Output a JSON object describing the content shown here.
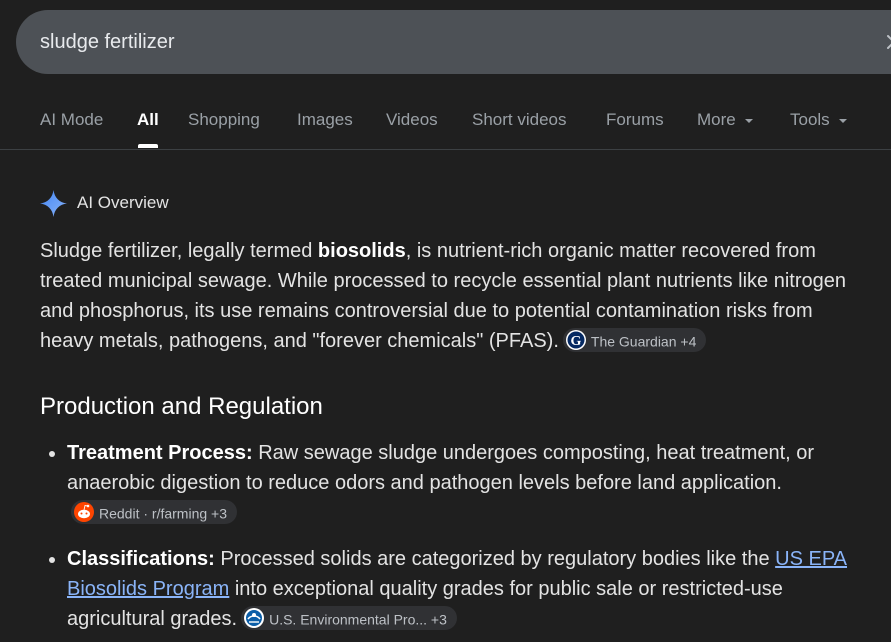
{
  "search": {
    "query": "sludge fertilizer"
  },
  "tabs": [
    {
      "label": "AI Mode"
    },
    {
      "label": "All"
    },
    {
      "label": "Shopping"
    },
    {
      "label": "Images"
    },
    {
      "label": "Videos"
    },
    {
      "label": "Short videos"
    },
    {
      "label": "Forums"
    },
    {
      "label": "More"
    },
    {
      "label": "Tools"
    }
  ],
  "ai_overview": {
    "title": "AI Overview",
    "intro_before": "Sludge fertilizer, legally termed ",
    "intro_bold": "biosolids",
    "intro_after": ", is nutrient-rich organic matter recovered from treated municipal sewage. While processed to recycle essential plant nutrients like nitrogen and phosphorus, its use remains controversial due to potential contamination risks from heavy metals, pathogens, and \"forever chemicals\" (PFAS).",
    "intro_source": "The Guardian +4",
    "section_title": "Production and Regulation",
    "bullets": [
      {
        "label": "Treatment Process:",
        "text": " Raw sewage sludge undergoes composting, heat treatment, or anaerobic digestion to reduce odors and pathogen levels before land application.",
        "source": "Reddit · r/farming +3"
      },
      {
        "label": "Classifications:",
        "text_before": " Processed solids are categorized by regulatory bodies like the ",
        "link": "US EPA Biosolids Program",
        "text_after": " into exceptional quality grades for public sale or restricted-use agricultural grades.",
        "source": "U.S. Environmental Pro... +3"
      }
    ]
  },
  "colors": {
    "background": "#1f1f1f",
    "search_bar": "#4d5156",
    "link": "#8ab4f8",
    "chip": "#303134",
    "reddit": "#ff4500"
  },
  "icons": {
    "clear": "close-icon",
    "sparkle": "gemini-sparkle-icon",
    "guardian": "guardian-logo-icon",
    "reddit": "reddit-logo-icon",
    "epa": "epa-logo-icon",
    "caret": "caret-down-icon"
  }
}
